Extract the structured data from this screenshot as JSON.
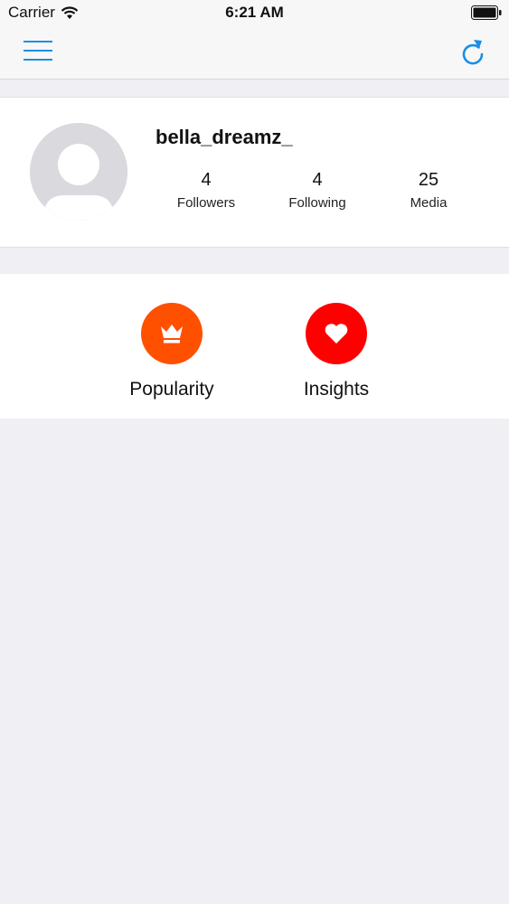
{
  "status_bar": {
    "carrier": "Carrier",
    "time": "6:21 AM",
    "icons": [
      "wifi-icon",
      "battery-icon"
    ]
  },
  "nav_bar": {
    "left_icon": "menu-icon",
    "right_icon": "refresh-icon",
    "accent_color": "#1a8fe3"
  },
  "profile": {
    "username": "bella_dreamz_",
    "avatar_icon": "avatar-placeholder-icon",
    "stats": [
      {
        "value": "4",
        "label": "Followers"
      },
      {
        "value": "4",
        "label": "Following"
      },
      {
        "value": "25",
        "label": "Media"
      }
    ]
  },
  "actions": [
    {
      "label": "Popularity",
      "icon": "crown-icon",
      "color": "#ff5000"
    },
    {
      "label": "Insights",
      "icon": "heart-icon",
      "color": "#ff0000"
    }
  ]
}
